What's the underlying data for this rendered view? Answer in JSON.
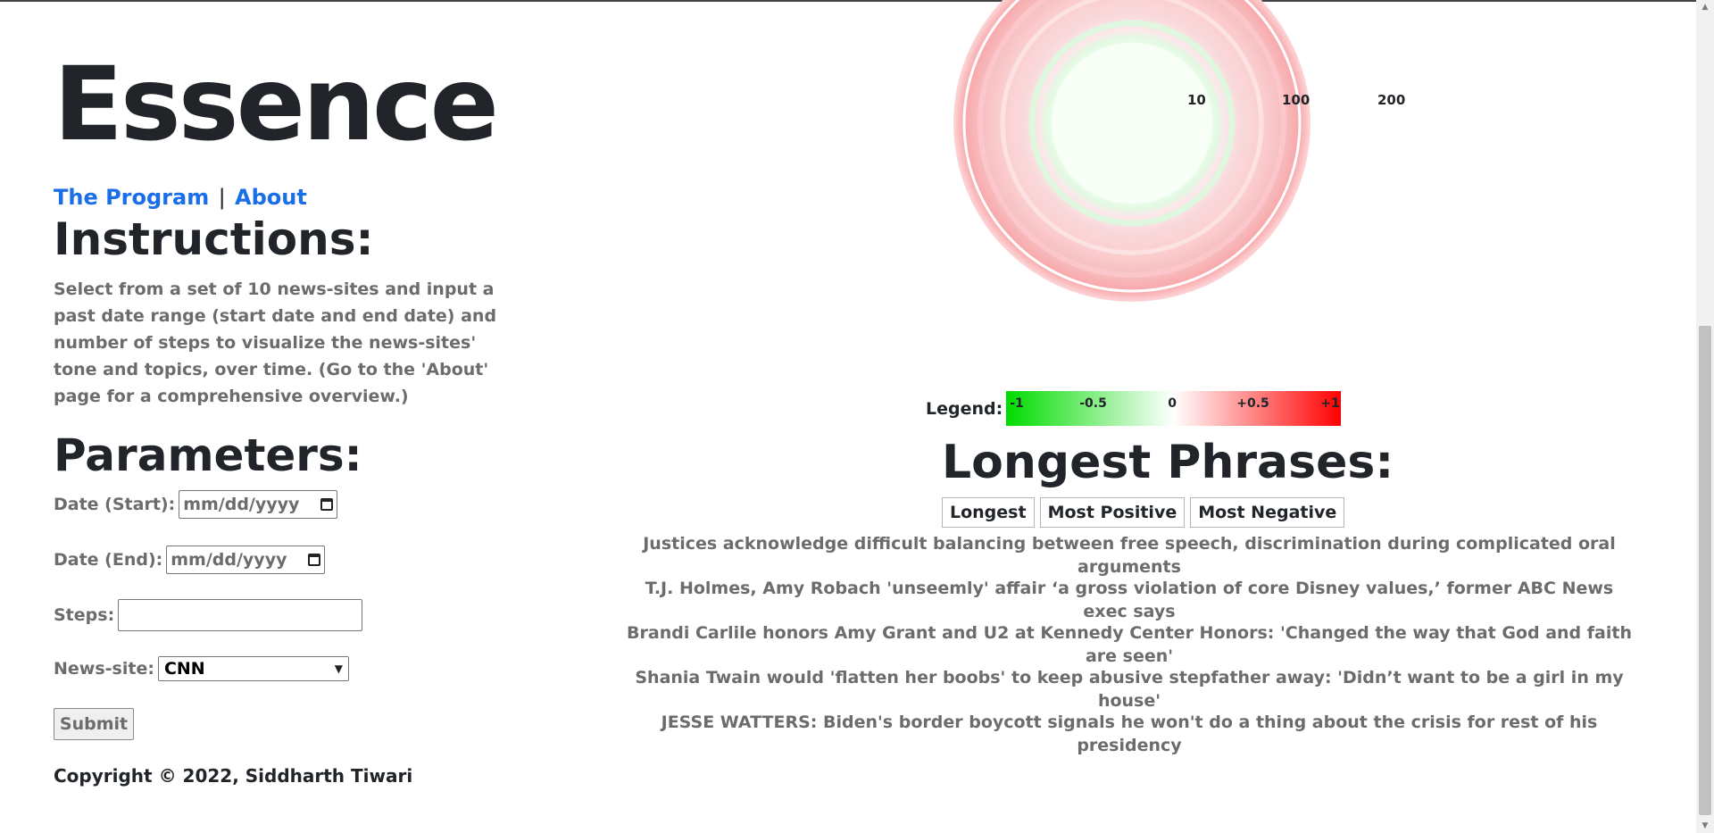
{
  "app": {
    "title": "Essence"
  },
  "nav": {
    "program_label": "The Program",
    "separator": "|",
    "about_label": "About"
  },
  "instructions": {
    "heading": "Instructions:",
    "text": "Select from a set of 10 news-sites and input a past date range (start date and end date) and number of steps to visualize the news-sites' tone and topics, over time. (Go to the 'About' page for a comprehensive overview.)"
  },
  "parameters": {
    "heading": "Parameters:",
    "date_start_label": "Date (Start):",
    "date_start_placeholder": "mm/dd/yyyy",
    "date_end_label": "Date (End):",
    "date_end_placeholder": "mm/dd/yyyy",
    "steps_label": "Steps:",
    "steps_value": "",
    "newssite_label": "News-site:",
    "newssite_selected": "CNN",
    "submit_label": "Submit"
  },
  "footer": {
    "copyright": "Copyright © 2022, Siddharth Tiwari"
  },
  "chart": {
    "type": "radial",
    "ring_labels": [
      "10",
      "100",
      "200"
    ],
    "colors": {
      "positive": "#00dc00",
      "neutral": "#ffffff",
      "negative": "#ff0000"
    }
  },
  "legend": {
    "label": "Legend:",
    "ticks": [
      "-1",
      "-0.5",
      "0",
      "+0.5",
      "+1"
    ]
  },
  "phrases": {
    "heading": "Longest Phrases:",
    "tabs": [
      "Longest",
      "Most Positive",
      "Most Negative"
    ],
    "items": [
      "Justices acknowledge difficult balancing between free speech, discrimination during complicated oral arguments",
      "T.J. Holmes, Amy Robach 'unseemly' affair ‘a gross violation of core Disney values,’ former ABC News exec says",
      "Brandi Carlile honors Amy Grant and U2 at Kennedy Center Honors: 'Changed the way that God and faith are seen'",
      "Shania Twain would 'flatten her boobs' to keep abusive stepfather away: 'Didn’t want to be a girl in my house'",
      "JESSE WATTERS: Biden's border boycott signals he won't do a thing about the crisis for rest of his presidency"
    ]
  }
}
